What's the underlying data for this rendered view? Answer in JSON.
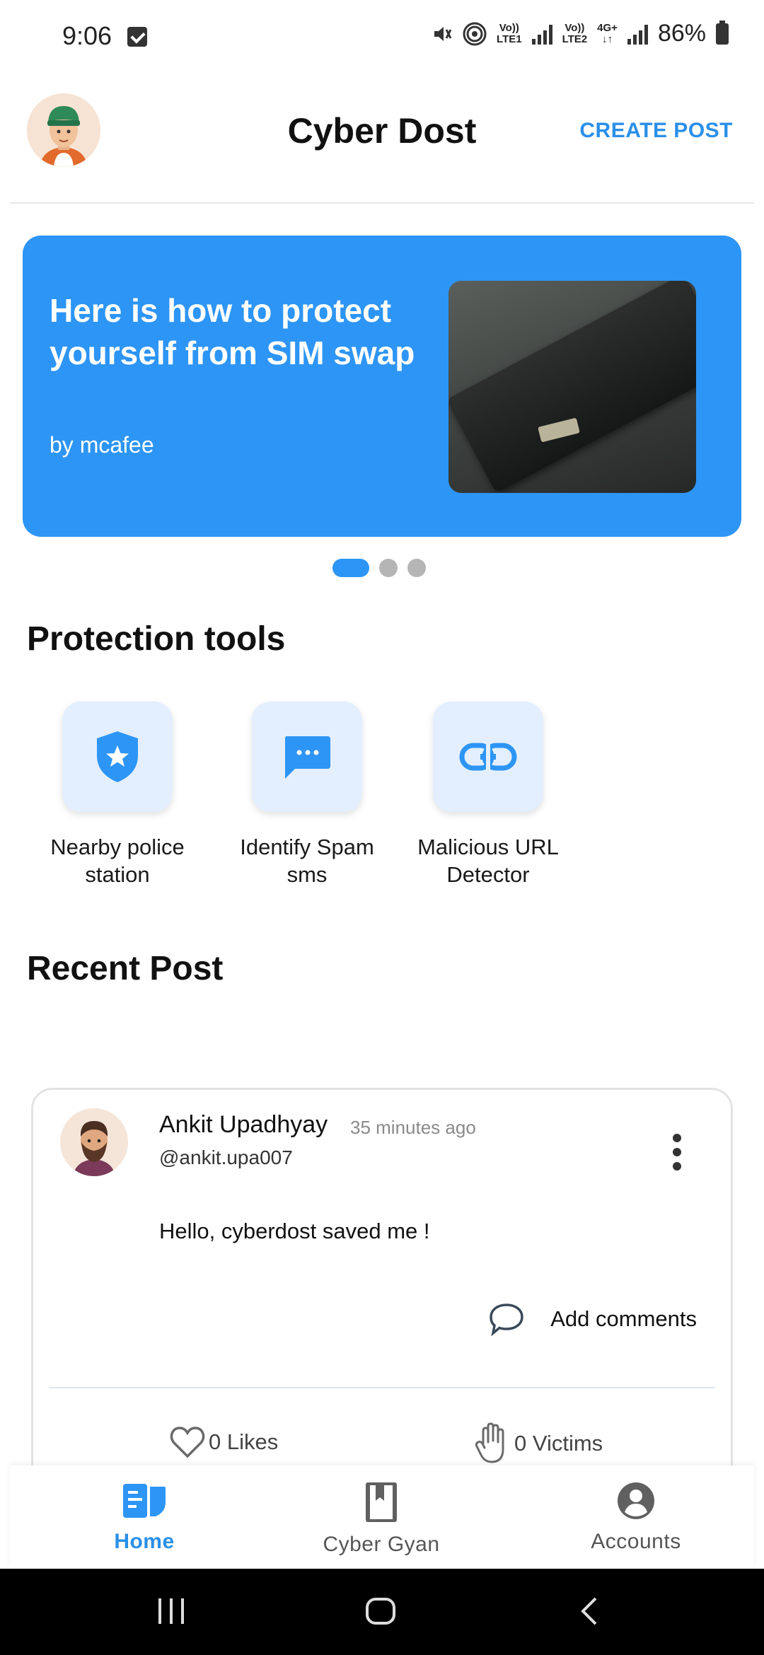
{
  "status_bar": {
    "time": "9:06",
    "sim1_label_top": "Vo))",
    "sim1_label_bottom": "LTE1",
    "sim2_label_top": "Vo))",
    "sim2_label_bottom": "LTE2",
    "net_top": "4G+",
    "net_bottom": "↓↑",
    "battery": "86%"
  },
  "header": {
    "title": "Cyber Dost",
    "create_post": "CREATE POST"
  },
  "banner": {
    "title": "Here is how to protect yourself from SIM swap",
    "byline": "by mcafee",
    "slides_total": 3,
    "active_slide": 1
  },
  "tools": {
    "title": "Protection tools",
    "items": [
      {
        "label": "Nearby police station",
        "icon": "shield-star-icon"
      },
      {
        "label": "Identify Spam sms",
        "icon": "chat-bubble-icon"
      },
      {
        "label": "Malicious URL Detector",
        "icon": "link-icon"
      }
    ]
  },
  "recent": {
    "title": "Recent Post",
    "post": {
      "author": "Ankit Upadhyay",
      "time": "35 minutes ago",
      "handle": "@ankit.upa007",
      "body": "Hello, cyberdost saved me !",
      "add_comments": "Add comments",
      "likes": "0 Likes",
      "victims": "0 Victims"
    }
  },
  "bottom_nav": {
    "items": [
      {
        "label": "Home",
        "active": true
      },
      {
        "label": "Cyber Gyan",
        "active": false
      },
      {
        "label": "Accounts",
        "active": false
      }
    ]
  },
  "colors": {
    "accent": "#2d95f5",
    "link": "#2a8fe8",
    "tool_bg": "#e3efff"
  }
}
